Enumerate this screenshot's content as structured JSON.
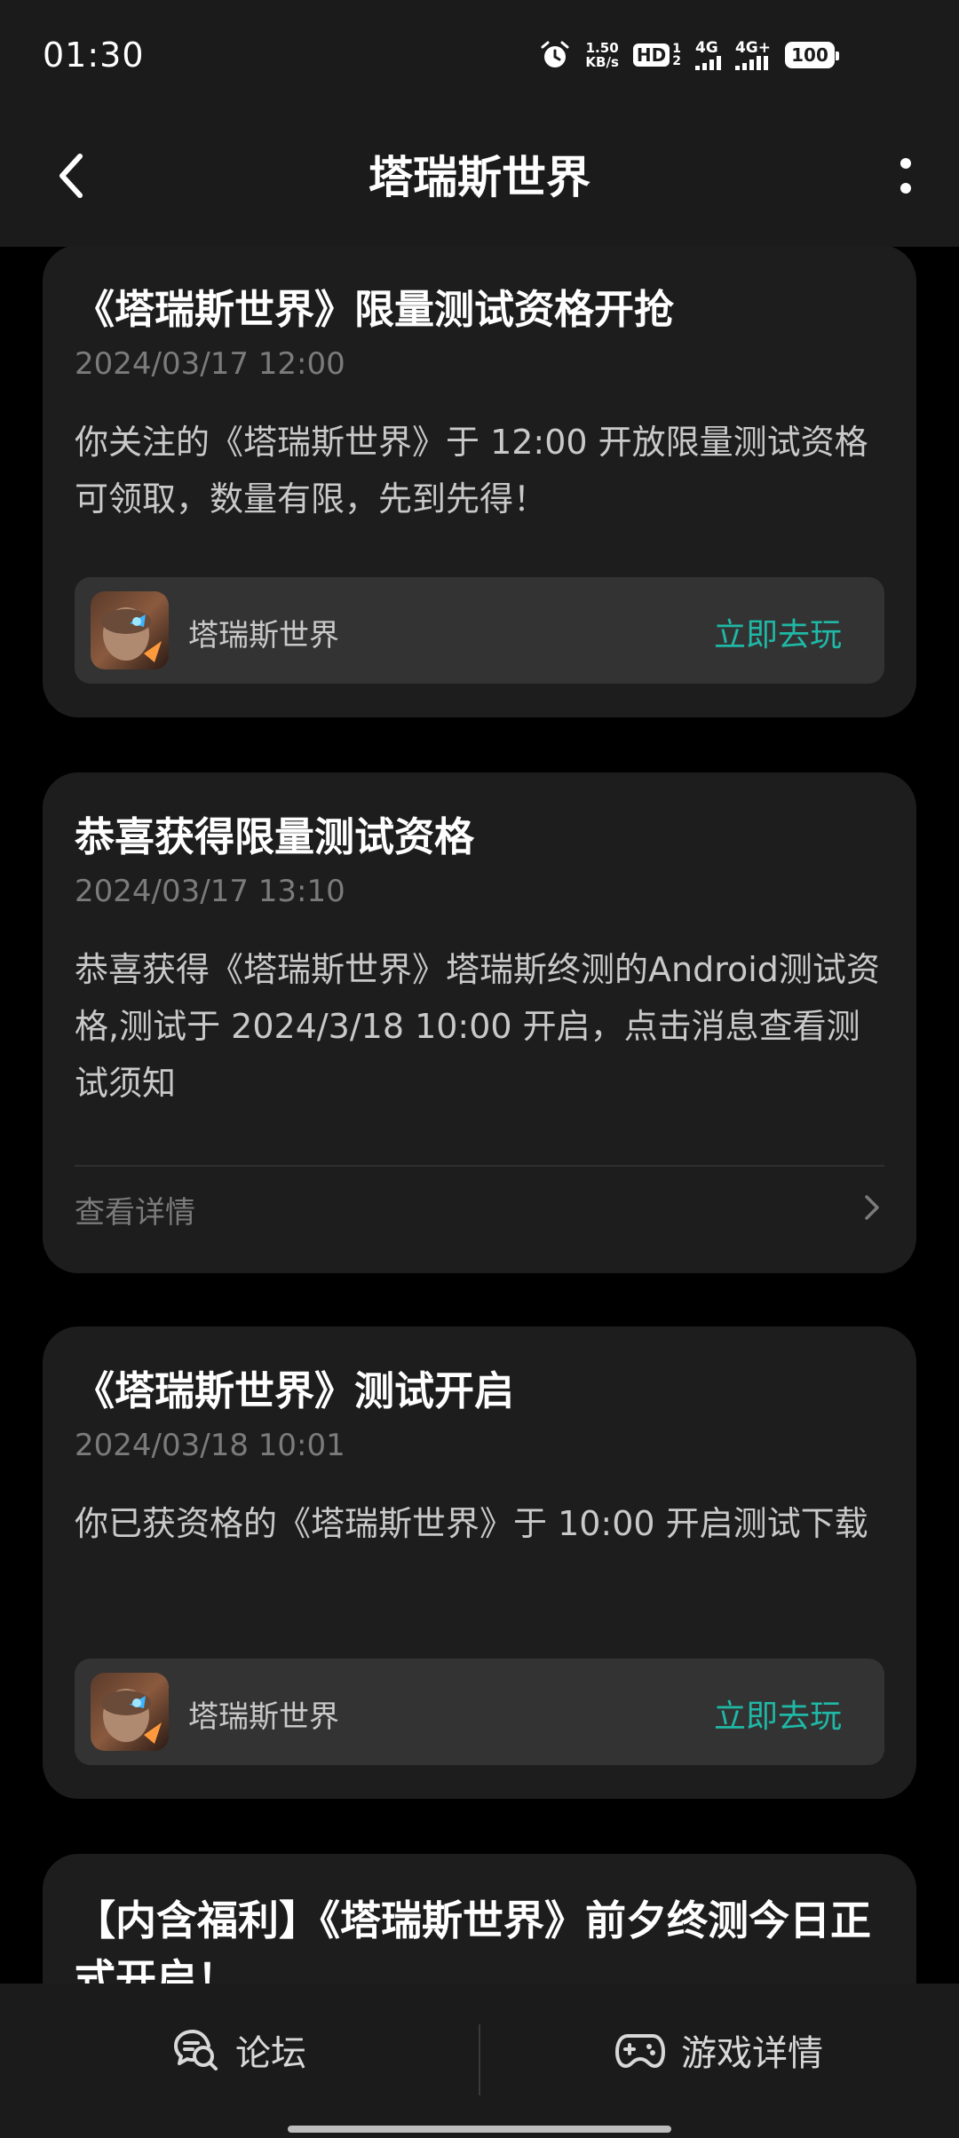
{
  "status_bar": {
    "time": "01:30",
    "net_speed_value": "1.50",
    "net_speed_unit": "KB/s",
    "hd_label": "HD",
    "hd_sub_top": "1",
    "hd_sub_bottom": "2",
    "signal1_label": "4G",
    "signal2_label": "4G+",
    "battery": "100"
  },
  "header": {
    "title": "塔瑞斯世界"
  },
  "cards": [
    {
      "title": "《塔瑞斯世界》限量测试资格开抢",
      "date": "2024/03/17 12:00",
      "body": "你关注的《塔瑞斯世界》于 12:00 开放限量测试资格可领取，数量有限，先到先得！",
      "game_name": "塔瑞斯世界",
      "action_label": "立即去玩"
    },
    {
      "title": "恭喜获得限量测试资格",
      "date": "2024/03/17 13:10",
      "body": "恭喜获得《塔瑞斯世界》塔瑞斯终测的Android测试资格,测试于 2024/3/18 10:00 开启，点击消息查看测试须知",
      "detail_label": "查看详情"
    },
    {
      "title": "《塔瑞斯世界》测试开启",
      "date": "2024/03/18 10:01",
      "body": "你已获资格的《塔瑞斯世界》于 10:00 开启测试下载",
      "game_name": "塔瑞斯世界",
      "action_label": "立即去玩"
    },
    {
      "title": "【内含福利】《塔瑞斯世界》前夕终测今日正式开启！"
    }
  ],
  "bottom_bar": {
    "forum_label": "论坛",
    "game_detail_label": "游戏详情"
  },
  "colors": {
    "accent": "#1fb8a6",
    "card_bg": "#1d1d1d",
    "bar_bg": "#1b1b1b"
  }
}
